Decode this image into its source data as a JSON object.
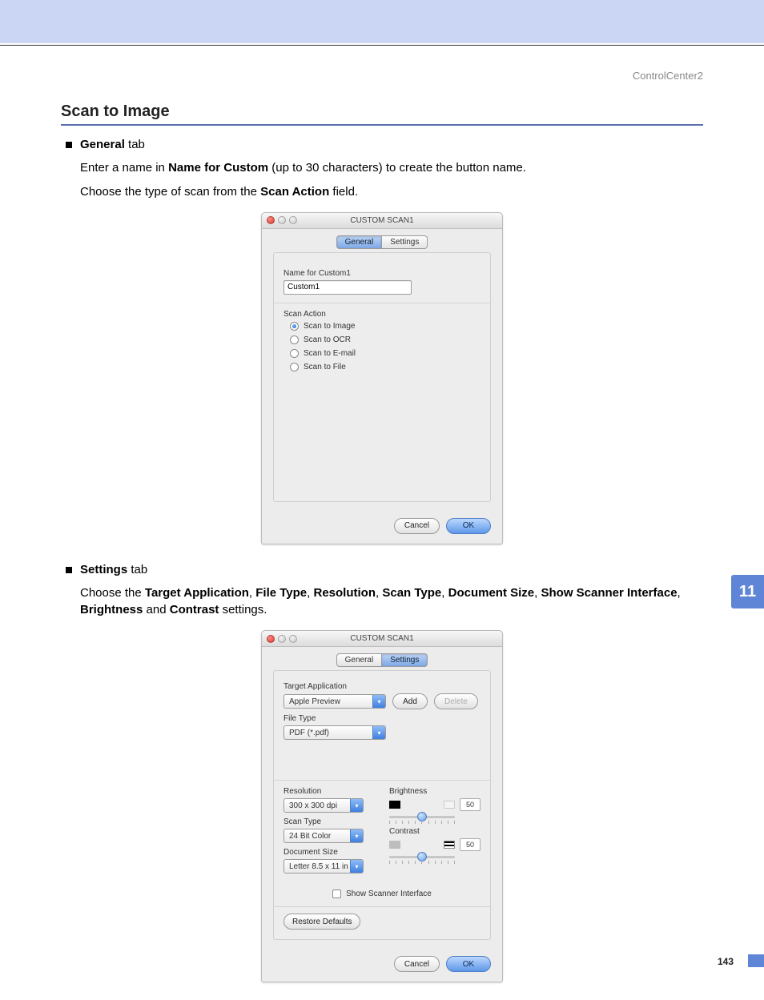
{
  "header_right": "ControlCenter2",
  "section_title": "Scan to Image",
  "general_bullet_prefix": "General",
  "general_bullet_suffix": " tab",
  "general_p1_a": "Enter a name in ",
  "general_p1_b": "Name for Custom",
  "general_p1_c": " (up to 30 characters) to create the button name.",
  "general_p2_a": "Choose the type of scan from the ",
  "general_p2_b": "Scan Action",
  "general_p2_c": " field.",
  "settings_bullet_prefix": "Settings",
  "settings_bullet_suffix": " tab",
  "settings_p1_parts": [
    "Choose the ",
    "Target Application",
    ", ",
    "File Type",
    ", ",
    "Resolution",
    ", ",
    "Scan Type",
    ", ",
    "Document Size",
    ", ",
    "Show Scanner Interface",
    ", ",
    "Brightness",
    " and ",
    "Contrast",
    " settings."
  ],
  "dialog1": {
    "title": "CUSTOM SCAN1",
    "tab_general": "General",
    "tab_settings": "Settings",
    "name_label": "Name for Custom1",
    "name_value": "Custom1",
    "action_label": "Scan Action",
    "actions": [
      "Scan to Image",
      "Scan to OCR",
      "Scan to E-mail",
      "Scan to File"
    ],
    "selected_index": 0,
    "cancel": "Cancel",
    "ok": "OK"
  },
  "dialog2": {
    "title": "CUSTOM SCAN1",
    "tab_general": "General",
    "tab_settings": "Settings",
    "target_label": "Target Application",
    "target_value": "Apple Preview",
    "add": "Add",
    "delete": "Delete",
    "file_type_label": "File Type",
    "file_type_value": "PDF (*.pdf)",
    "res_label": "Resolution",
    "res_value": "300 x 300 dpi",
    "scan_type_label": "Scan Type",
    "scan_type_value": "24 Bit Color",
    "doc_size_label": "Document Size",
    "doc_size_value": "Letter  8.5 x 11 in",
    "brightness_label": "Brightness",
    "brightness_value": "50",
    "contrast_label": "Contrast",
    "contrast_value": "50",
    "show_scanner_label": "Show Scanner Interface",
    "restore_defaults": "Restore Defaults",
    "cancel": "Cancel",
    "ok": "OK"
  },
  "chapter": "11",
  "page": "143"
}
